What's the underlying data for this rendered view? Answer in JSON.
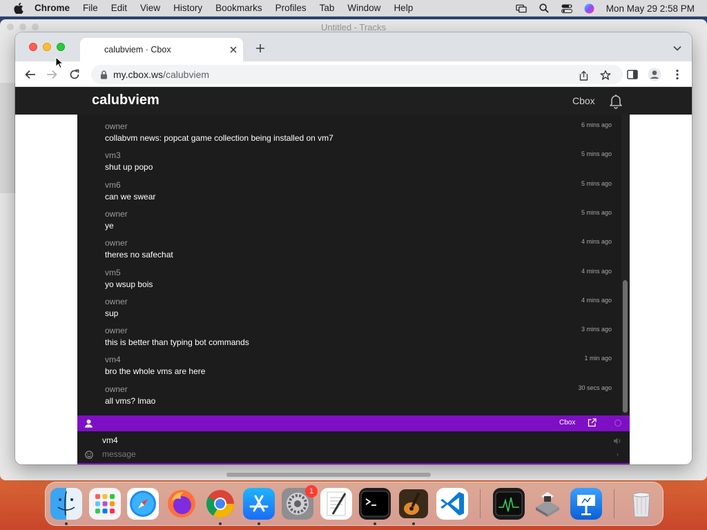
{
  "menubar": {
    "app": "Chrome",
    "items": [
      "File",
      "Edit",
      "View",
      "History",
      "Bookmarks",
      "Profiles",
      "Tab",
      "Window",
      "Help"
    ],
    "clock": "Mon May 29  2:58 PM"
  },
  "background_window": {
    "title": "Untitled - Tracks"
  },
  "browser": {
    "tab_title": "calubviem · Cbox",
    "url_host": "my.cbox.ws",
    "url_path": "/calubviem"
  },
  "site": {
    "title": "calubviem",
    "nav_cbox": "Cbox"
  },
  "chat": {
    "messages": [
      {
        "user": "owner",
        "text": "collabvm news: popcat game collection being installed on vm7",
        "ago": "6 mins ago"
      },
      {
        "user": "vm3",
        "text": "shut up popo",
        "ago": "5 mins ago"
      },
      {
        "user": "vm6",
        "text": "can we swear",
        "ago": "5 mins ago"
      },
      {
        "user": "owner",
        "text": "ye",
        "ago": "5 mins ago"
      },
      {
        "user": "owner",
        "text": "theres no safechat",
        "ago": "4 mins ago"
      },
      {
        "user": "vm5",
        "text": "yo wsup bois",
        "ago": "4 mins ago"
      },
      {
        "user": "owner",
        "text": "sup",
        "ago": "4 mins ago"
      },
      {
        "user": "owner",
        "text": "this is better than typing bot commands",
        "ago": "3 mins ago"
      },
      {
        "user": "vm4",
        "text": "bro the whole vms are here",
        "ago": "1 min ago"
      },
      {
        "user": "owner",
        "text": "all vms? lmao",
        "ago": "30 secs ago"
      }
    ],
    "bar_brand": "Cbox",
    "accent_color": "#7e0fc4",
    "compose": {
      "name": "vm4",
      "placeholder": "message",
      "send_glyph": "›"
    }
  },
  "dock": {
    "apps": [
      "finder",
      "launchpad",
      "safari",
      "firefox",
      "chrome",
      "app-store",
      "system-settings",
      "textedit",
      "terminal",
      "garageband",
      "vscode",
      "activity-monitor",
      "boot-camp-assistant",
      "keynote",
      "trash"
    ],
    "settings_badge": "1"
  }
}
